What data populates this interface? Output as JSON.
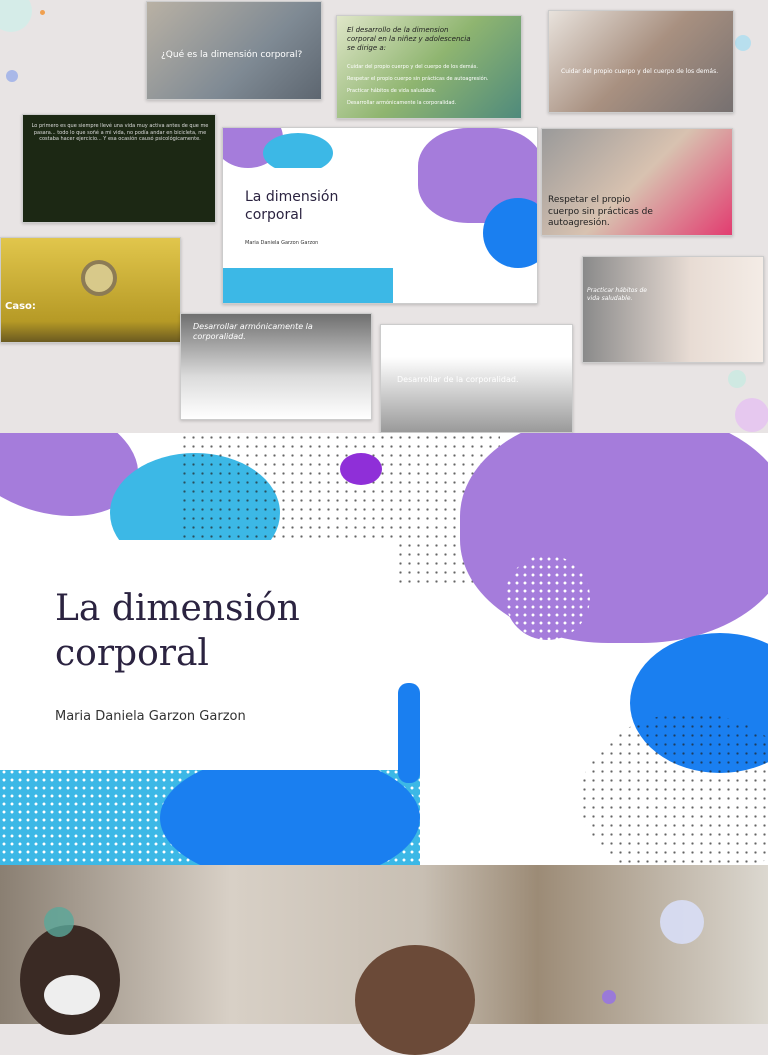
{
  "thumbnails": [
    {
      "text": "¿Qué es la dimensión corporal?"
    },
    {
      "title": "El desarrollo de la dimension corporal en la niñez y adolescencia se dirige a:",
      "bullets": [
        "Cuidar del propio cuerpo y del cuerpo de los demás.",
        "Respetar el propio cuerpo sin prácticas de autoagresión.",
        "Practicar hábitos de vida saludable.",
        "Desarrollar armónicamente la corporalidad."
      ]
    },
    {
      "text": "Cuidar del propio cuerpo y del cuerpo de los demás."
    },
    {
      "text": "Lo primero es que siempre llevé una vida muy activa antes de que me pasara... todo lo que soñé a mi vida, no podía andar en bicicleta, me costaba hacer ejercicio... Y esa ocasión causó psicológicamente."
    },
    {
      "title": "La dimensión corporal",
      "author": "Maria Daniela Garzon Garzon"
    },
    {
      "text": "Respetar el propio cuerpo sin prácticas de autoagresión."
    },
    {
      "text": "Caso:"
    },
    {
      "text": "Practicar hábitos de vida saludable."
    },
    {
      "text": "Desarrollar armónicamente la corporalidad."
    },
    {
      "text": "Desarrollar de la corporalidad."
    }
  ],
  "main_slide": {
    "title": "La dimensión corporal",
    "author": "Maria Daniela Garzon Garzon"
  },
  "colors": {
    "purple": "#a57cdb",
    "cyan": "#3cb8e6",
    "blue": "#1a7ff0",
    "title": "#2b2340"
  }
}
